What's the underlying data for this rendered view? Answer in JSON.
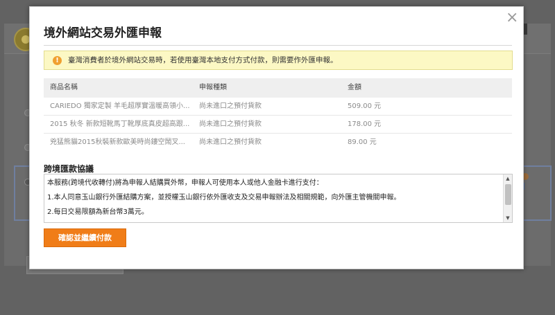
{
  "modal": {
    "title": "境外網站交易外匯申報",
    "close_glyph": "×",
    "notice": {
      "icon": "!",
      "text": "臺灣消費者於境外網站交易時，若使用臺灣本地支付方式付款，則需要作外匯申報。"
    },
    "table": {
      "headers": [
        "商品名稱",
        "申報種類",
        "金額"
      ],
      "rows": [
        {
          "name": "CARIEDO 獨家定製 羊毛超厚實溫暖高領小...",
          "type": "尚未進口之預付貨款",
          "amount": "509.00 元"
        },
        {
          "name": "2015 秋冬 新款短靴馬丁靴厚底真皮超高跟...",
          "type": "尚未進口之預付貨款",
          "amount": "178.00 元"
        },
        {
          "name": "兇猛熊貓2015秋裝新款歐美時尚鏤空鬧叉...",
          "type": "尚未進口之預付貨款",
          "amount": "89.00 元"
        }
      ]
    },
    "agreement": {
      "title": "跨境匯款協議",
      "lines": [
        "本服務(跨境代收轉付)將為申報人結購買外幣，申報人可使用本人或他人金融卡進行支付：",
        "1.本人同意玉山銀行外匯結購方案，並授權玉山銀行依外匯收支及交易申報辦法及相關規範，向外匯主管機關申報。",
        "2.每日交易限額為新台幣3萬元。"
      ]
    },
    "confirm_button": "確認並繼續付款"
  },
  "colors": {
    "accent_orange": "#f07d18",
    "notice_bg": "#fcf8c4",
    "overlay": "#5b5b5b"
  },
  "icons": {
    "close": "close-icon",
    "notice": "warning-icon",
    "scroll_up": "chevron-up-icon",
    "scroll_down": "chevron-down-icon"
  }
}
